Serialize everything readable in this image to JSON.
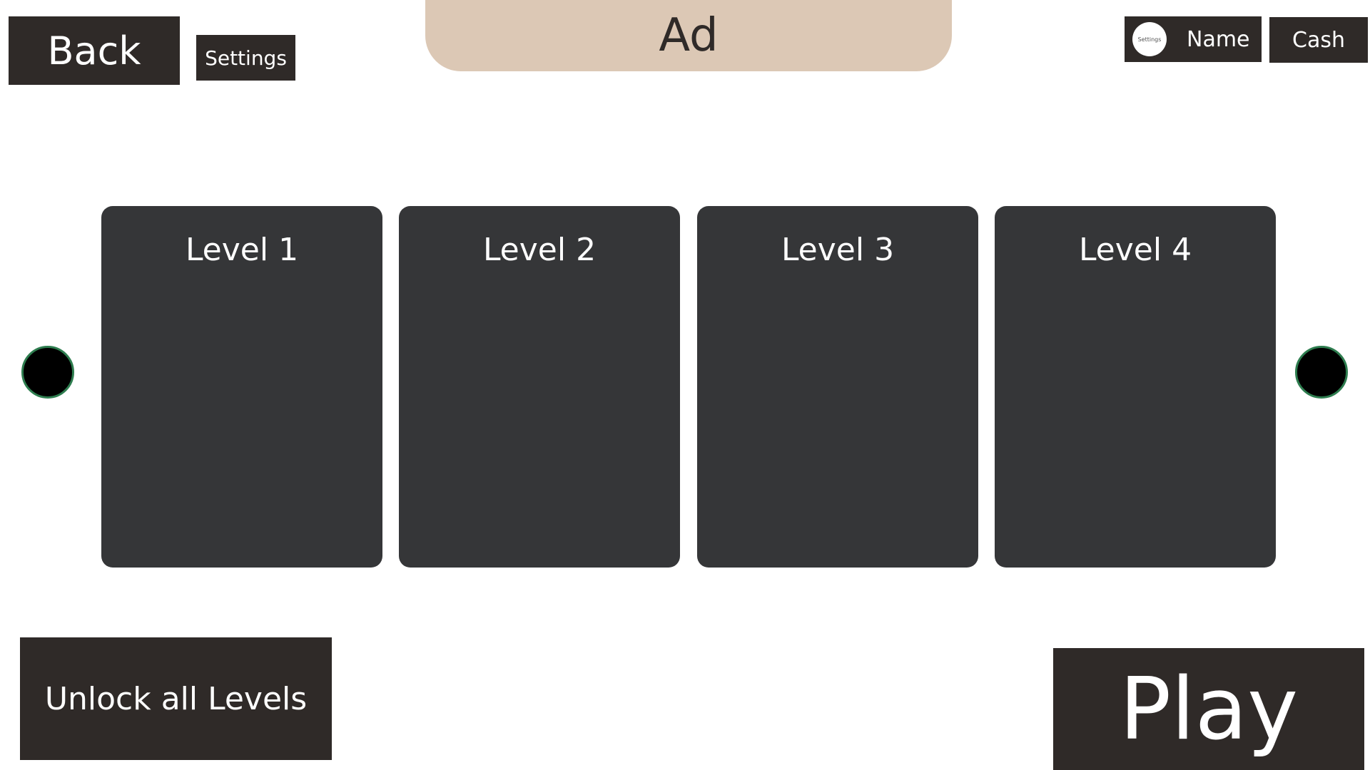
{
  "header": {
    "back_label": "Back",
    "settings_label": "Settings",
    "ad_label": "Ad",
    "profile": {
      "avatar_label": "Settings",
      "name": "Name"
    },
    "cash_label": "Cash"
  },
  "levels": [
    {
      "label": "Level 1"
    },
    {
      "label": "Level 2"
    },
    {
      "label": "Level 3"
    },
    {
      "label": "Level 4"
    }
  ],
  "footer": {
    "unlock_label": "Unlock all Levels",
    "play_label": "Play"
  },
  "colors": {
    "button_dark": "#2f2a28",
    "card": "#353638",
    "ad": "#dcc8b5",
    "arrow_ring": "#2e7d4f"
  }
}
